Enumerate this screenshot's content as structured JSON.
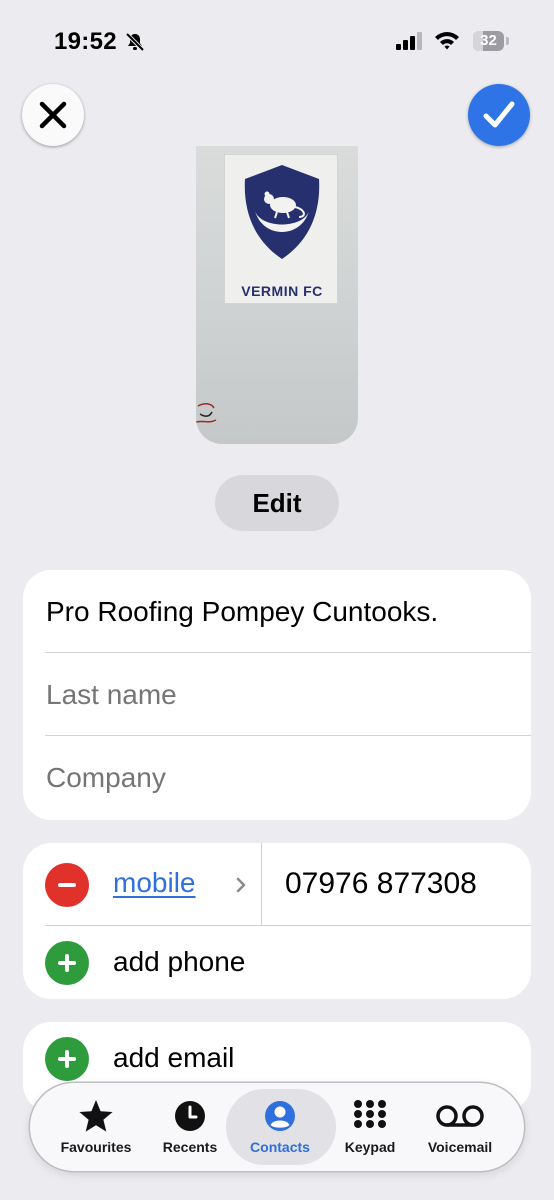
{
  "status": {
    "time": "19:52",
    "battery": "32",
    "battery_level": 0.32
  },
  "nav": {
    "close_icon": "close-icon",
    "done_icon": "checkmark-icon"
  },
  "poster": {
    "sticker_text": "VERMIN FC"
  },
  "edit_label": "Edit",
  "name_fields": {
    "first_name": "Pro Roofing Pompey Cuntooks.",
    "last_name_placeholder": "Last name",
    "company_placeholder": "Company"
  },
  "phone": {
    "label": "mobile",
    "number": "07976 877308",
    "add_phone": "add phone"
  },
  "email": {
    "add_email": "add email"
  },
  "tabs": [
    {
      "label": "Favourites",
      "icon": "star-icon"
    },
    {
      "label": "Recents",
      "icon": "clock-icon"
    },
    {
      "label": "Contacts",
      "icon": "person-icon",
      "active": true
    },
    {
      "label": "Keypad",
      "icon": "keypad-icon"
    },
    {
      "label": "Voicemail",
      "icon": "voicemail-icon"
    }
  ],
  "colors": {
    "accent": "#2f74e6",
    "remove": "#e0322b",
    "add": "#2e9c3c",
    "background": "#ececf0"
  }
}
